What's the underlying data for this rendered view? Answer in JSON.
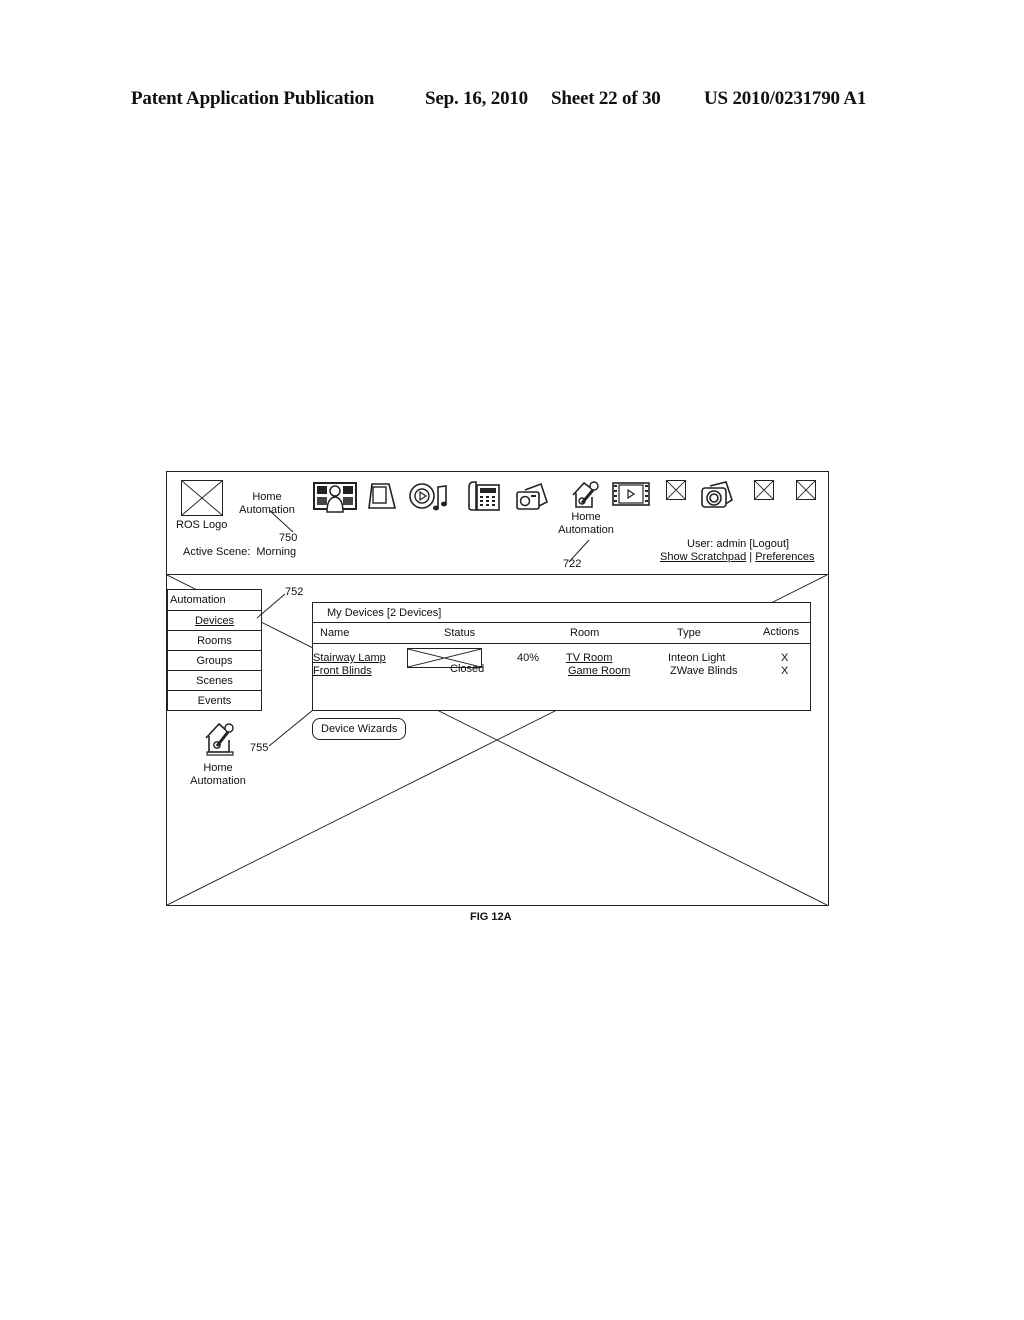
{
  "patent_header": {
    "publication": "Patent Application Publication",
    "date": "Sep. 16, 2010",
    "sheet": "Sheet 22 of 30",
    "number": "US 2010/0231790 A1"
  },
  "figure_label": "FIG 12A",
  "app": {
    "logo_label": "ROS Logo",
    "app_title_line1": "Home",
    "app_title_line2": "Automation",
    "active_scene_label": "Active Scene:",
    "active_scene_value": "Morning",
    "toolbar_icons": [
      {
        "name": "photos-icon"
      },
      {
        "name": "tablet-icon"
      },
      {
        "name": "music-icon"
      },
      {
        "name": "phone-icon"
      },
      {
        "name": "radio-icon"
      },
      {
        "name": "home-automation-icon",
        "label_line1": "Home",
        "label_line2": "Automation"
      },
      {
        "name": "video-icon"
      },
      {
        "name": "placeholder-icon"
      },
      {
        "name": "camera-icon"
      },
      {
        "name": "placeholder-icon"
      },
      {
        "name": "placeholder-icon"
      }
    ],
    "user_line": "User: admin [Logout]",
    "show_scratchpad": "Show Scratchpad",
    "separator": "|",
    "preferences": "Preferences"
  },
  "sidebar": {
    "header": "Automation",
    "items": [
      {
        "label": "Devices",
        "active": true
      },
      {
        "label": "Rooms"
      },
      {
        "label": "Groups"
      },
      {
        "label": "Scenes"
      },
      {
        "label": "Events"
      }
    ],
    "bottom_icon_label_line1": "Home",
    "bottom_icon_label_line2": "Automation"
  },
  "devices_panel": {
    "title": "My Devices [2 Devices]",
    "columns": [
      "Name",
      "Status",
      "Room",
      "Type",
      "Actions"
    ],
    "rows": [
      {
        "name": "Stairway Lamp",
        "status": "40%",
        "room": "TV Room",
        "type": "Inteon Light",
        "action": "X"
      },
      {
        "name": "Front Blinds",
        "status": "Closed",
        "room": "Game Room",
        "type": "ZWave Blinds",
        "action": "X"
      }
    ]
  },
  "device_wizards_button": "Device Wizards",
  "reference_numerals": {
    "r750": "750",
    "r722": "722",
    "r752": "752",
    "r755": "755"
  }
}
